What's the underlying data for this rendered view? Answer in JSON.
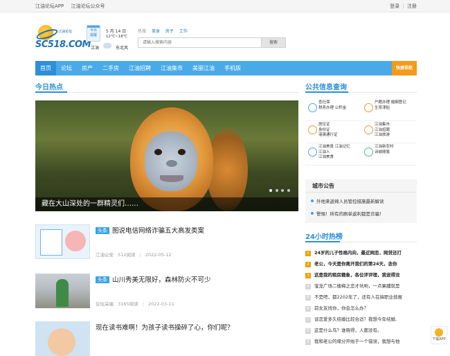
{
  "topbar": {
    "links": [
      "江油论坛APP",
      "江油论坛公众号"
    ],
    "login": "登录",
    "divider": "|",
    "register": "注册"
  },
  "logo": {
    "tagline": "江油论坛",
    "brand": "SC518.COM"
  },
  "weather": {
    "calendar": [
      "今日",
      "提醒"
    ],
    "date": "5 月 14 日",
    "temp": "12℃~18℃",
    "city": "江油",
    "wind": "东北风"
  },
  "hotwords": {
    "label": "热搜",
    "words": [
      "美食",
      "房子",
      "工作"
    ]
  },
  "search": {
    "placeholder": "请输入搜索内容",
    "button": "搜索"
  },
  "nav": {
    "items": [
      "首页",
      "论坛",
      "房产",
      "二手房",
      "江油招聘",
      "江油集市",
      "美丽江油",
      "手机版"
    ],
    "quick": "快捷导航"
  },
  "today": {
    "title": "今日热点"
  },
  "slider": {
    "caption": "藏在大山深处的一群精灵们……",
    "dots": 4
  },
  "articles": [
    {
      "tag": "头条",
      "title": "图说电信网络诈骗五大高发类案",
      "source": "江油公安",
      "views": "512阅读",
      "date": "2022-05-12"
    },
    {
      "tag": "头条",
      "title": "山川秀美无限好，森林防火不可少",
      "source": "论坛采编",
      "views": "3165阅读",
      "date": "2022-03-11"
    },
    {
      "tag": "",
      "title": "现在读书难啊！为孩子读书操碎了心，你们呢？",
      "source": "",
      "views": "",
      "date": ""
    }
  ],
  "services": {
    "title": "公共信息查询",
    "cells": [
      {
        "lines": [
          "查社保",
          "税务办理  公积金"
        ],
        "icon": "shield-icon",
        "color": "#49a6df"
      },
      {
        "lines": [
          "户籍办理  婚姻登记",
          "生育津贴"
        ],
        "icon": "id-card-icon",
        "color": "#f09a2b"
      },
      {
        "lines": [
          "居住证",
          "身份证",
          "港澳通行证"
        ],
        "icon": "document-icon",
        "color": "#f09a2b"
      },
      {
        "lines": [
          "江油集市",
          "江油招聘",
          "江油旅游"
        ],
        "icon": "map-icon",
        "color": "#f09a2b"
      },
      {
        "lines": [
          "江油美景  江油记忆",
          "江油人",
          "江油美食"
        ],
        "icon": "camera-icon",
        "color": "#49a6df"
      },
      {
        "lines": [
          "江油新农村",
          "诗城随笔"
        ],
        "icon": "book-icon",
        "color": "#3fbca0"
      }
    ]
  },
  "notice": {
    "title": "城市公告",
    "items": [
      "外地来返绵人员管控措施最新解读",
      "警惕！所有的刷单返利都是诈骗！"
    ]
  },
  "hot24": {
    "title": "24小时热榜",
    "items": [
      {
        "rank": "1",
        "text": "24岁的儿子性格内向，最近网恋，网贷还打"
      },
      {
        "rank": "2",
        "text": "老公，今天是你离开我们的第24天，念你"
      },
      {
        "rank": "3",
        "text": "这是我的租房籍象，各位评评理，我说得没"
      },
      {
        "rank": "4",
        "text": "宝龙广场二楼梅之恋才坑哟，一点果脯就是"
      },
      {
        "rank": "5",
        "text": "不是吧，都2202年了，还有人在搞职业技报"
      },
      {
        "rank": "6",
        "text": "前女友找你，你会怎么办？"
      },
      {
        "rank": "7",
        "text": "谈恋爱多久结婚比较合适？我想今年结婚,"
      },
      {
        "rank": "8",
        "text": "这是什么鸟？谁晓得，人都没有。"
      },
      {
        "rank": "9",
        "text": "我和老公的缘分开始于一个错误，我想与他"
      }
    ]
  },
  "float": {
    "label": "下载APP"
  }
}
